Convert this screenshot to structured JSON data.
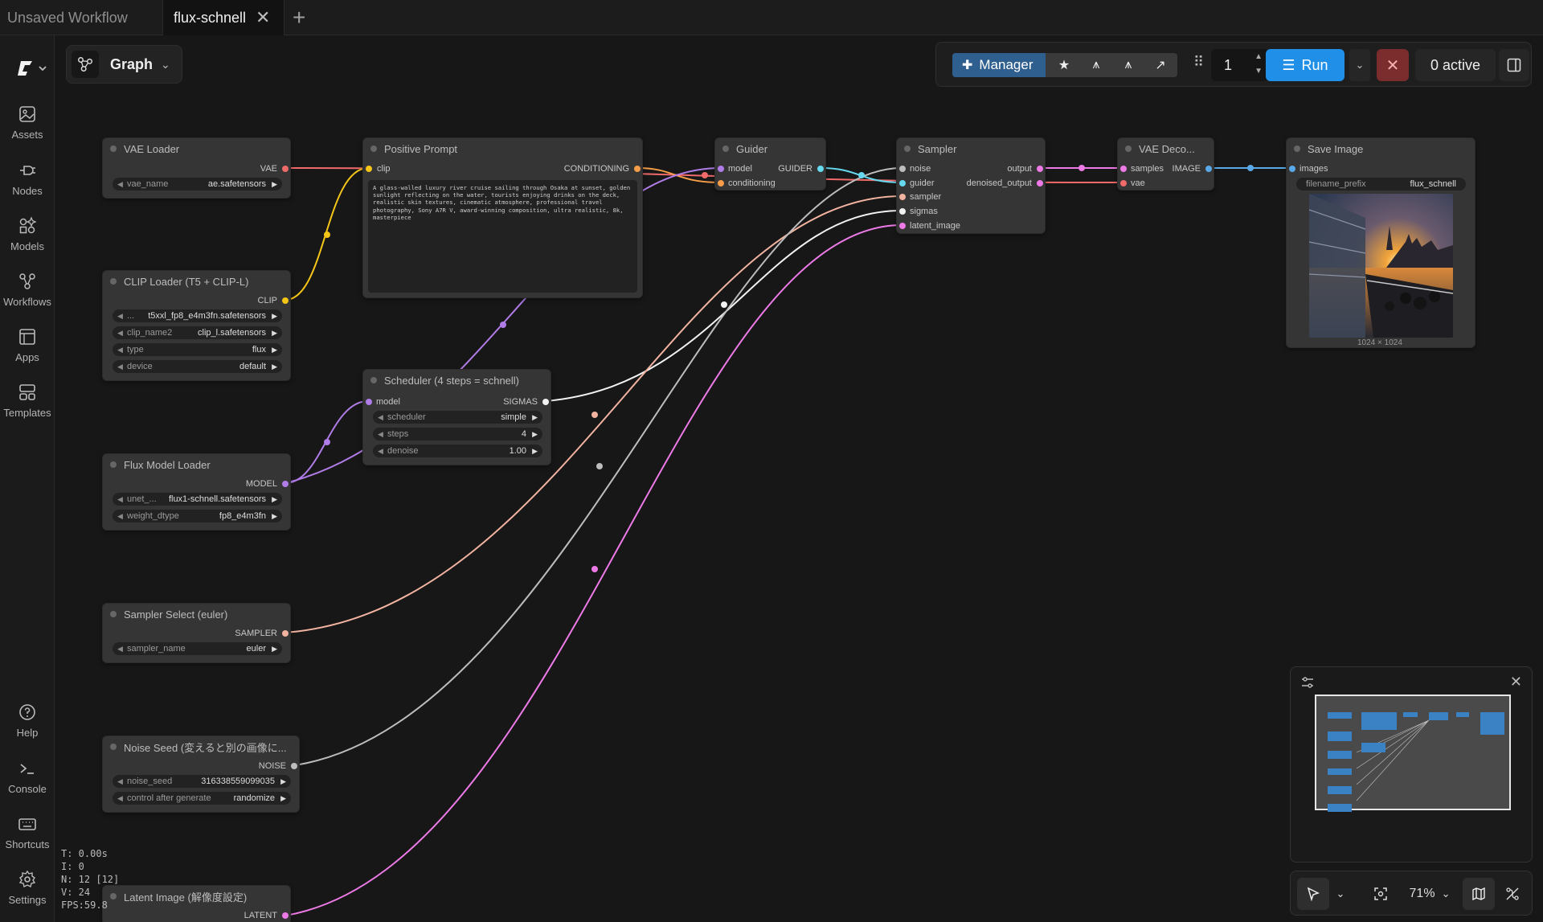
{
  "tabs": [
    {
      "label": "Unsaved Workflow"
    },
    {
      "label": "flux-schnell",
      "active": true
    }
  ],
  "graph_button": {
    "label": "Graph"
  },
  "sidebar": {
    "items": [
      {
        "label": "Assets",
        "icon": "image-icon"
      },
      {
        "label": "Nodes",
        "icon": "plug-icon"
      },
      {
        "label": "Models",
        "icon": "shapes-icon"
      },
      {
        "label": "Workflows",
        "icon": "workflow-icon"
      },
      {
        "label": "Apps",
        "icon": "app-window-icon"
      },
      {
        "label": "Templates",
        "icon": "template-icon"
      }
    ],
    "bottom_items": [
      {
        "label": "Help",
        "icon": "help-icon"
      },
      {
        "label": "Console",
        "icon": "terminal-icon"
      },
      {
        "label": "Shortcuts",
        "icon": "keyboard-icon"
      },
      {
        "label": "Settings",
        "icon": "gear-icon"
      }
    ]
  },
  "toolbar": {
    "manager_label": "Manager",
    "queue_count": "1",
    "run_label": "Run",
    "active_label": "0 active"
  },
  "nodes": {
    "vae_loader": {
      "title": "VAE Loader",
      "out": "VAE",
      "w1_name": "vae_name",
      "w1_value": "ae.safetensors"
    },
    "clip_loader": {
      "title": "CLIP Loader (T5 + CLIP-L)",
      "out": "CLIP",
      "w1_name": "...",
      "w1_value": "t5xxl_fp8_e4m3fn.safetensors",
      "w2_name": "clip_name2",
      "w2_value": "clip_l.safetensors",
      "w3_name": "type",
      "w3_value": "flux",
      "w4_name": "device",
      "w4_value": "default"
    },
    "flux_loader": {
      "title": "Flux Model Loader",
      "out": "MODEL",
      "w1_name": "unet_...",
      "w1_value": "flux1-schnell.safetensors",
      "w2_name": "weight_dtype",
      "w2_value": "fp8_e4m3fn"
    },
    "sampler_select": {
      "title": "Sampler Select (euler)",
      "out": "SAMPLER",
      "w1_name": "sampler_name",
      "w1_value": "euler"
    },
    "noise_seed": {
      "title": "Noise Seed (変えると別の画像に...",
      "out": "NOISE",
      "w1_name": "noise_seed",
      "w1_value": "316338559099035",
      "w2_name": "control after generate",
      "w2_value": "randomize"
    },
    "latent_image": {
      "title": "Latent Image (解像度設定)",
      "out": "LATENT"
    },
    "positive_prompt": {
      "title": "Positive Prompt",
      "in": "clip",
      "out": "CONDITIONING",
      "text": "A glass-walled luxury river cruise sailing through Osaka at sunset, golden sunlight reflecting on the water, tourists enjoying drinks on the deck, realistic skin textures, cinematic atmosphere, professional travel photography, Sony A7R V, award-winning composition, ultra realistic, 8k, masterpiece"
    },
    "scheduler": {
      "title": "Scheduler (4 steps = schnell)",
      "in": "model",
      "out": "SIGMAS",
      "w1_name": "scheduler",
      "w1_value": "simple",
      "w2_name": "steps",
      "w2_value": "4",
      "w3_name": "denoise",
      "w3_value": "1.00"
    },
    "guider": {
      "title": "Guider",
      "in1": "model",
      "in2": "conditioning",
      "out": "GUIDER"
    },
    "sampler": {
      "title": "Sampler",
      "in1": "noise",
      "in2": "guider",
      "in3": "sampler",
      "in4": "sigmas",
      "in5": "latent_image",
      "out1": "output",
      "out2": "denoised_output"
    },
    "vae_decode": {
      "title": "VAE Deco...",
      "in1": "samples",
      "in2": "vae",
      "out": "IMAGE"
    },
    "save_image": {
      "title": "Save Image",
      "in": "images",
      "w1_name": "filename_prefix",
      "w1_value": "flux_schnell",
      "caption": "1024 × 1024"
    }
  },
  "stats": {
    "t": "T: 0.00s",
    "i": "I: 0",
    "n": "N: 12 [12]",
    "v": "V: 24",
    "fps": "FPS:59.8"
  },
  "canvas_controls": {
    "zoom": "71%"
  },
  "colors": {
    "accent": "#1f8fe8",
    "vae": "#f06a6a",
    "clip": "#f5c518",
    "model": "#b07ce8",
    "conditioning": "#f79d4a",
    "latent": "#ee7ae8",
    "sigmas": "#ffffff",
    "noise": "#bdbdbd",
    "sampler": "#f2b3a0",
    "guider": "#66d9ef",
    "image": "#5aa9e6"
  }
}
